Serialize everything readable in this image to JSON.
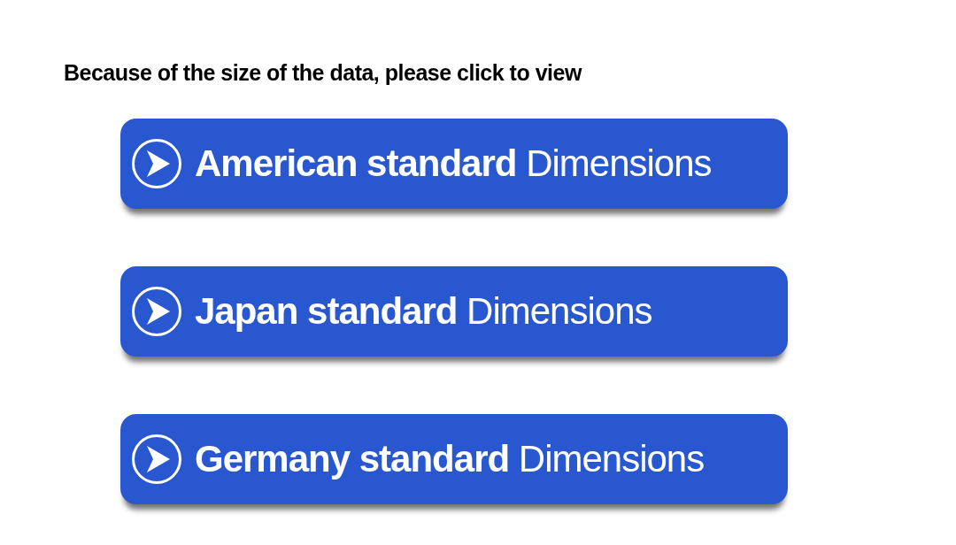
{
  "heading": "Because of the size of the data, please click to view",
  "buttons": [
    {
      "label": "**American standard** Dimensions"
    },
    {
      "label": "**Japan standard** Dimensions"
    },
    {
      "label": "**Germany standard** Dimensions"
    }
  ]
}
